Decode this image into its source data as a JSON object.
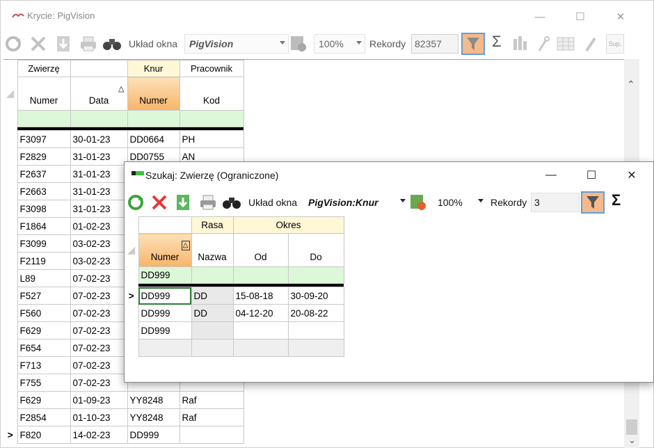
{
  "main": {
    "title": "Krycie: PigVision",
    "toolbar": {
      "layout_label": "Układ okna",
      "layout_value": "PigVision",
      "zoom_value": "100%",
      "records_label": "Rekordy",
      "records_value": "82357",
      "sigma_label": "Σ",
      "sup_label": "Sup."
    },
    "grid": {
      "bands": [
        "Zwierzę",
        "",
        "Knur",
        "Pracownik"
      ],
      "columns": [
        "Numer",
        "Data",
        "Numer",
        "Kod"
      ],
      "sort_indicator": "△",
      "rows": [
        [
          "F3097",
          "30-01-23",
          "DD0664",
          "PH"
        ],
        [
          "F2829",
          "31-01-23",
          "DD0755",
          "AN"
        ],
        [
          "F2637",
          "31-01-23",
          "",
          ""
        ],
        [
          "F2663",
          "31-01-23",
          "",
          ""
        ],
        [
          "F3098",
          "31-01-23",
          "",
          ""
        ],
        [
          "F1864",
          "01-02-23",
          "",
          ""
        ],
        [
          "F3099",
          "03-02-23",
          "",
          ""
        ],
        [
          "F2119",
          "03-02-23",
          "",
          ""
        ],
        [
          "L89",
          "07-02-23",
          "",
          ""
        ],
        [
          "F527",
          "07-02-23",
          "",
          ""
        ],
        [
          "F560",
          "07-02-23",
          "",
          ""
        ],
        [
          "F629",
          "07-02-23",
          "",
          ""
        ],
        [
          "F654",
          "07-02-23",
          "",
          ""
        ],
        [
          "F713",
          "07-02-23",
          "",
          ""
        ],
        [
          "F755",
          "07-02-23",
          "",
          ""
        ],
        [
          "F629",
          "01-09-23",
          "YY8248",
          "Raf"
        ],
        [
          "F2854",
          "01-10-23",
          "YY8248",
          "Raf"
        ],
        [
          "F820",
          "14-02-23",
          "DD999",
          ""
        ]
      ],
      "current_marker": ">"
    }
  },
  "dialog": {
    "title": "Szukaj: Zwierzę (Ograniczone)",
    "toolbar": {
      "layout_label": "Układ okna",
      "layout_value": "PigVision:Knur",
      "zoom_value": "100%",
      "records_label": "Rekordy",
      "records_value": "3",
      "sigma_label": "Σ"
    },
    "grid": {
      "bands": [
        "",
        "Rasa",
        "Okres"
      ],
      "columns": [
        "Numer",
        "Nazwa",
        "Od",
        "Do"
      ],
      "filter_value": "DD999",
      "sort_indicator": "△",
      "rows": [
        [
          "DD999",
          "DD",
          "15-08-18",
          "30-09-20"
        ],
        [
          "DD999",
          "DD",
          "04-12-20",
          "20-08-22"
        ],
        [
          "DD999",
          "",
          "",
          ""
        ],
        [
          "",
          "",
          "",
          ""
        ]
      ],
      "current_marker": ">"
    }
  },
  "colors": {
    "accent_orange": "#f6b56a",
    "filter_green": "#ddf7d9",
    "band_yellow": "#fff7d6",
    "filter_button": "#f6b98a"
  }
}
